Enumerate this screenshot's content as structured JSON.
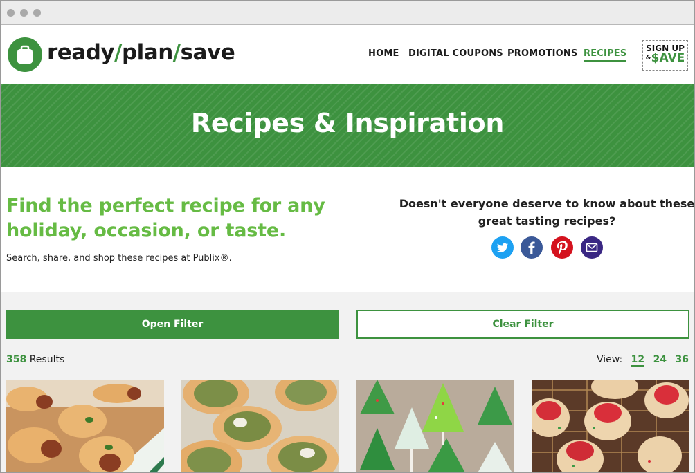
{
  "logo": {
    "part1": "ready",
    "slash1": "/",
    "part2": "plan",
    "slash2": "/",
    "part3": "save"
  },
  "nav": {
    "home": "HOME",
    "coupons": "DIGITAL COUPONS",
    "promotions": "PROMOTIONS",
    "recipes": "RECIPES"
  },
  "signup": {
    "line1": "SIGN UP",
    "amp": "&",
    "line2": "$AVE"
  },
  "banner": {
    "title": "Recipes & Inspiration"
  },
  "intro": {
    "headline": "Find the perfect recipe for any holiday, occasion, or taste.",
    "subtext": "Search, share, and shop these recipes at Publix®.",
    "share_question": "Doesn't everyone deserve to know about these great tasting recipes?"
  },
  "social": [
    {
      "icon": "twitter-icon",
      "color": "#1da1f2"
    },
    {
      "icon": "facebook-icon",
      "color": "#3b5998"
    },
    {
      "icon": "pinterest-icon",
      "color": "#d4121e"
    },
    {
      "icon": "email-icon",
      "color": "#3a2783"
    }
  ],
  "filters": {
    "open": "Open Filter",
    "clear": "Clear Filter"
  },
  "results": {
    "count": "358",
    "label": "Results"
  },
  "view": {
    "label": "View:",
    "options": [
      "12",
      "24",
      "36"
    ],
    "selected": "12"
  },
  "cards": [
    {
      "image": "pigs-in-a-blanket-photo"
    },
    {
      "image": "spinach-cups-photo"
    },
    {
      "image": "christmas-tree-cookies-photo"
    },
    {
      "image": "sprinkle-cookie-cups-photo"
    }
  ],
  "colors": {
    "brand_green": "#3d923f",
    "headline_green": "#66bb44"
  }
}
